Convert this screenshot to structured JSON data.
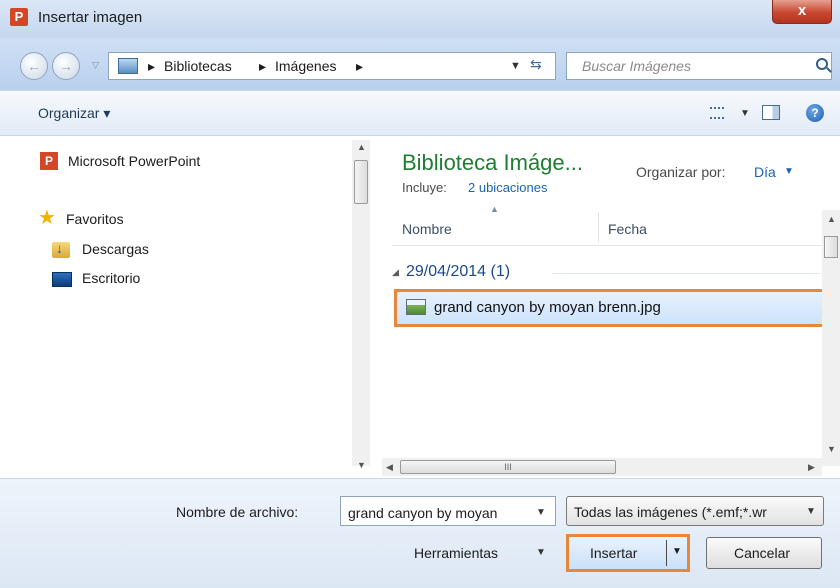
{
  "window": {
    "title": "Insertar imagen",
    "close_glyph": "x"
  },
  "address": {
    "crumbs": [
      "Bibliotecas",
      "Imágenes"
    ],
    "search_placeholder": "Buscar Imágenes"
  },
  "toolbar": {
    "organize_label": "Organizar ▾"
  },
  "nav_pane": {
    "items": [
      {
        "label": "Microsoft PowerPoint",
        "icon": "powerpoint-icon"
      },
      {
        "label": "Favoritos",
        "icon": "star-icon"
      },
      {
        "label": "Descargas",
        "icon": "downloads-folder-icon"
      },
      {
        "label": "Escritorio",
        "icon": "desktop-icon"
      }
    ]
  },
  "library": {
    "title": "Biblioteca Imáge...",
    "includes_label": "Incluye:",
    "includes_link": "2 ubicaciones",
    "organize_by_label": "Organizar por:",
    "organize_by_value": "Día"
  },
  "file_list": {
    "columns": [
      "Nombre",
      "Fecha"
    ],
    "group_label": "29/04/2014 (1)",
    "files": [
      {
        "name": "grand canyon by moyan brenn.jpg",
        "selected": true
      }
    ]
  },
  "footer": {
    "filename_label": "Nombre de archivo:",
    "filename_value": "grand canyon by moyan",
    "filter_value": "Todas las imágenes (*.emf;*.wr",
    "tools_label": "Herramientas",
    "insert_label": "Insertar",
    "cancel_label": "Cancelar"
  },
  "colors": {
    "highlight_orange": "#e8873a",
    "library_title_green": "#1e7f32",
    "link_blue": "#1a62b8"
  }
}
